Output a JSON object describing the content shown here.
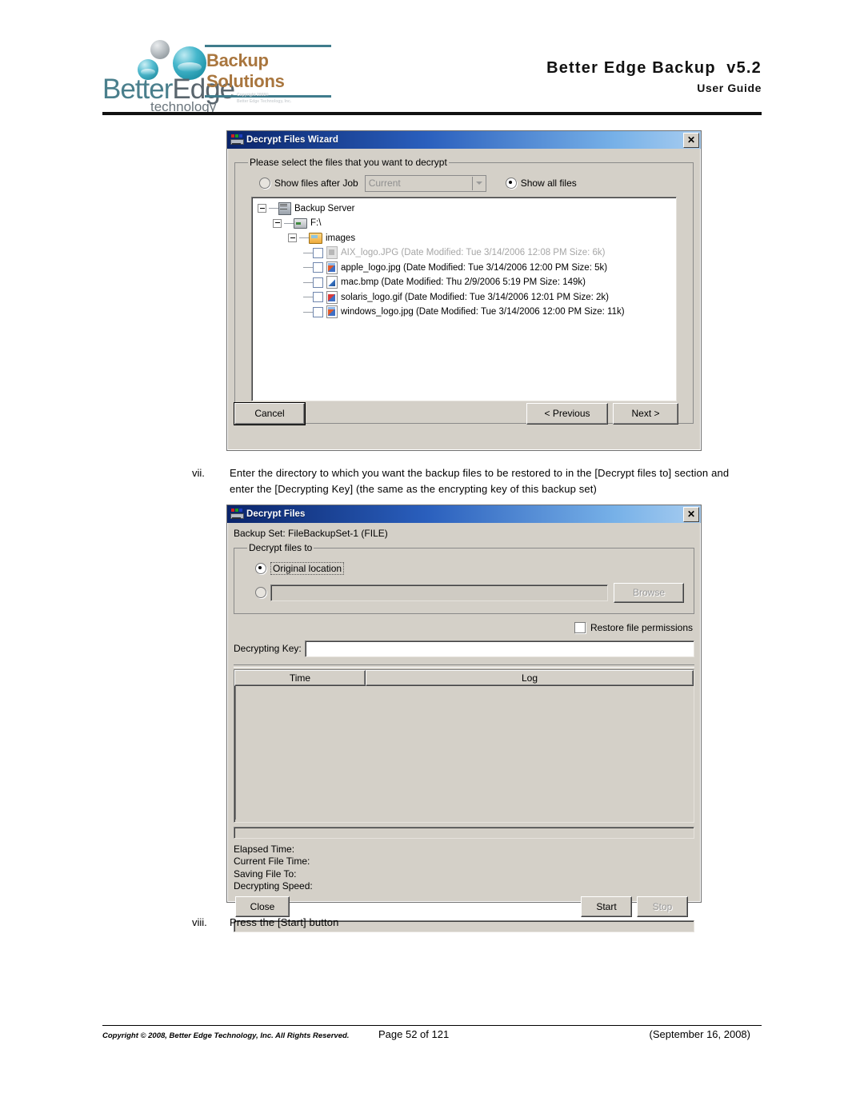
{
  "header": {
    "logo_better": "Better",
    "logo_edge": "Edge",
    "logo_tech": "technology",
    "backup_solutions": "Backup Solutions",
    "brand_copyright": "Copyright 2008©\nBetter Edge Technology, Inc.",
    "product_title": "Better  Edge  Backup",
    "product_version": "v5.2",
    "doc_type": "User Guide"
  },
  "wizard_dialog": {
    "title": "Decrypt Files Wizard",
    "close_label": "✕",
    "group_legend": "Please select the files that you want to decrypt",
    "radio_show_after_job": "Show files after Job",
    "job_combo_value": "Current",
    "radio_show_all_files": "Show all files",
    "tree": [
      {
        "label": "Backup Server",
        "icon": "server-icon",
        "level": 0,
        "kind": "node",
        "dim": false
      },
      {
        "label": "F:\\",
        "icon": "drive-icon",
        "level": 1,
        "kind": "node",
        "dim": false
      },
      {
        "label": "images",
        "icon": "folder-icon",
        "level": 2,
        "kind": "node",
        "dim": false
      },
      {
        "label": "AIX_logo.JPG (Date Modified: Tue 3/14/2006 12:08 PM Size: 6k)",
        "icon": "file-image-grey-icon",
        "level": 3,
        "kind": "file",
        "dim": true
      },
      {
        "label": "apple_logo.jpg (Date Modified: Tue 3/14/2006 12:00 PM Size: 5k)",
        "icon": "file-image-icon",
        "level": 3,
        "kind": "file",
        "dim": false
      },
      {
        "label": "mac.bmp (Date Modified: Thu 2/9/2006 5:19 PM Size: 149k)",
        "icon": "file-paint-icon",
        "level": 3,
        "kind": "file",
        "dim": false
      },
      {
        "label": "solaris_logo.gif (Date Modified: Tue 3/14/2006 12:01 PM Size: 2k)",
        "icon": "file-gif-icon",
        "level": 3,
        "kind": "file",
        "dim": false
      },
      {
        "label": "windows_logo.jpg (Date Modified: Tue 3/14/2006 12:00 PM Size: 11k)",
        "icon": "file-image-icon",
        "level": 3,
        "kind": "file",
        "dim": false
      }
    ],
    "cancel_label": "Cancel",
    "previous_label": "< Previous",
    "next_label": "Next >"
  },
  "step_vii": {
    "num": "vii.",
    "text": "Enter the directory to which you want the backup files to be restored to in the [Decrypt files to] section and enter the [Decrypting Key] (the same as the encrypting key of this backup set)"
  },
  "decrypt_dialog": {
    "title": "Decrypt Files",
    "close_label": "✕",
    "backup_set": "Backup Set: FileBackupSet-1 (FILE)",
    "group_legend": "Decrypt files to",
    "radio_original_location": "Original location",
    "path_value": "",
    "browse_label": "Browse",
    "restore_permissions_label": "Restore file permissions",
    "decrypting_key_label": "Decrypting Key:",
    "decrypting_key_value": "",
    "log_columns": [
      "Time",
      "Log"
    ],
    "log_rows": [],
    "status": [
      "Elapsed Time:",
      "Current File Time:",
      "Saving File To:",
      "Decrypting Speed:"
    ],
    "close_button": "Close",
    "start_button": "Start",
    "stop_button": "Stop"
  },
  "step_viii": {
    "num": "viii.",
    "text": "Press the [Start] button"
  },
  "footer": {
    "copyright": "Copyright © 2008, Better Edge Technology, Inc.   All Rights Reserved.",
    "page": "Page 52 of 121",
    "date": "(September 16, 2008)"
  }
}
